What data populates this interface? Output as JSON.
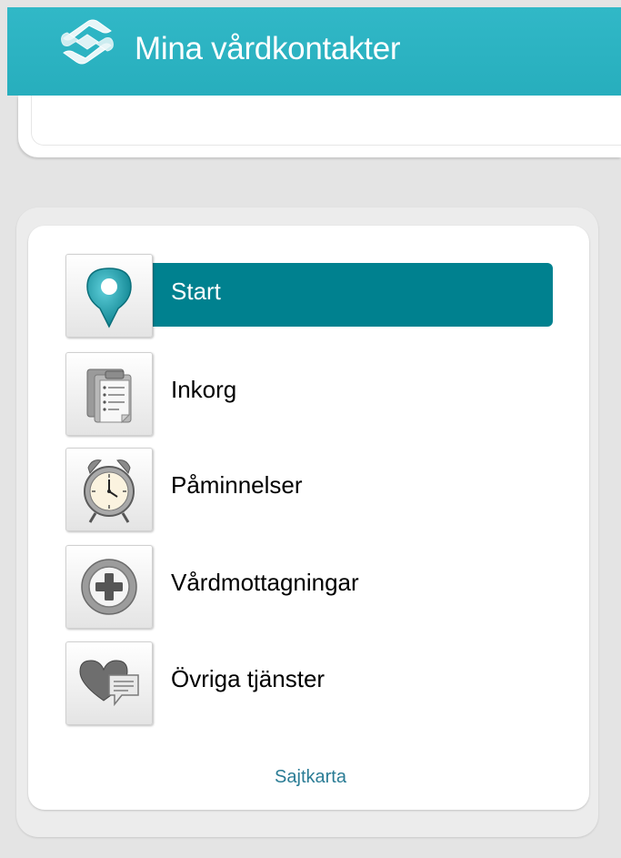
{
  "header": {
    "title": "Mina vårdkontakter",
    "logo_icon": "logo-icon",
    "color": "#2bb3c2"
  },
  "nav": {
    "active_color": "#00818f",
    "items": [
      {
        "label": "Start",
        "icon": "map-pin-icon",
        "active": true
      },
      {
        "label": "Inkorg",
        "icon": "clipboard-icon",
        "active": false
      },
      {
        "label": "Påminnelser",
        "icon": "alarm-clock-icon",
        "active": false
      },
      {
        "label": "Vårdmottagningar",
        "icon": "medical-cross-icon",
        "active": false
      },
      {
        "label": "Övriga tjänster",
        "icon": "heart-chat-icon",
        "active": false
      }
    ]
  },
  "footer": {
    "sitemap_link": "Sajtkarta"
  }
}
